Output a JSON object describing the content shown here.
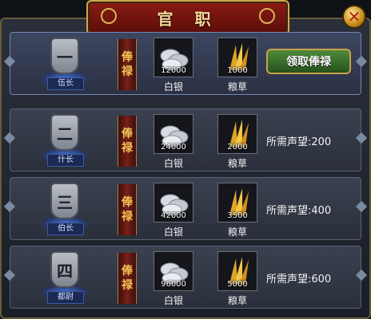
{
  "dialog": {
    "title": "官 职",
    "close_glyph": "✕"
  },
  "salary_tag": [
    "俸",
    "禄"
  ],
  "claim_button_label": "领取俸禄",
  "requirement_prefix": "所需声望:",
  "ranks": [
    {
      "numeral": "一",
      "name": "伍长",
      "silver": "12000",
      "grain": "1000",
      "silver_label": "白银",
      "grain_label": "粮草",
      "requirement": ""
    },
    {
      "numeral": "二",
      "name": "什长",
      "silver": "24000",
      "grain": "2000",
      "silver_label": "白银",
      "grain_label": "粮草",
      "requirement": "所需声望:200"
    },
    {
      "numeral": "三",
      "name": "伯长",
      "silver": "42000",
      "grain": "3500",
      "silver_label": "白银",
      "grain_label": "粮草",
      "requirement": "所需声望:400"
    },
    {
      "numeral": "四",
      "name": "都尉",
      "silver": "96000",
      "grain": "5000",
      "silver_label": "白银",
      "grain_label": "粮草",
      "requirement": "所需声望:600"
    }
  ],
  "colors": {
    "banner": "#8b1c14",
    "gold_trim": "#d1a64a",
    "claim_button": "#4f8a3a",
    "rank_glow": "#4682ff"
  },
  "icons": {
    "silver": "silver-ingot-icon",
    "grain": "wheat-grain-icon",
    "close": "close-icon"
  }
}
